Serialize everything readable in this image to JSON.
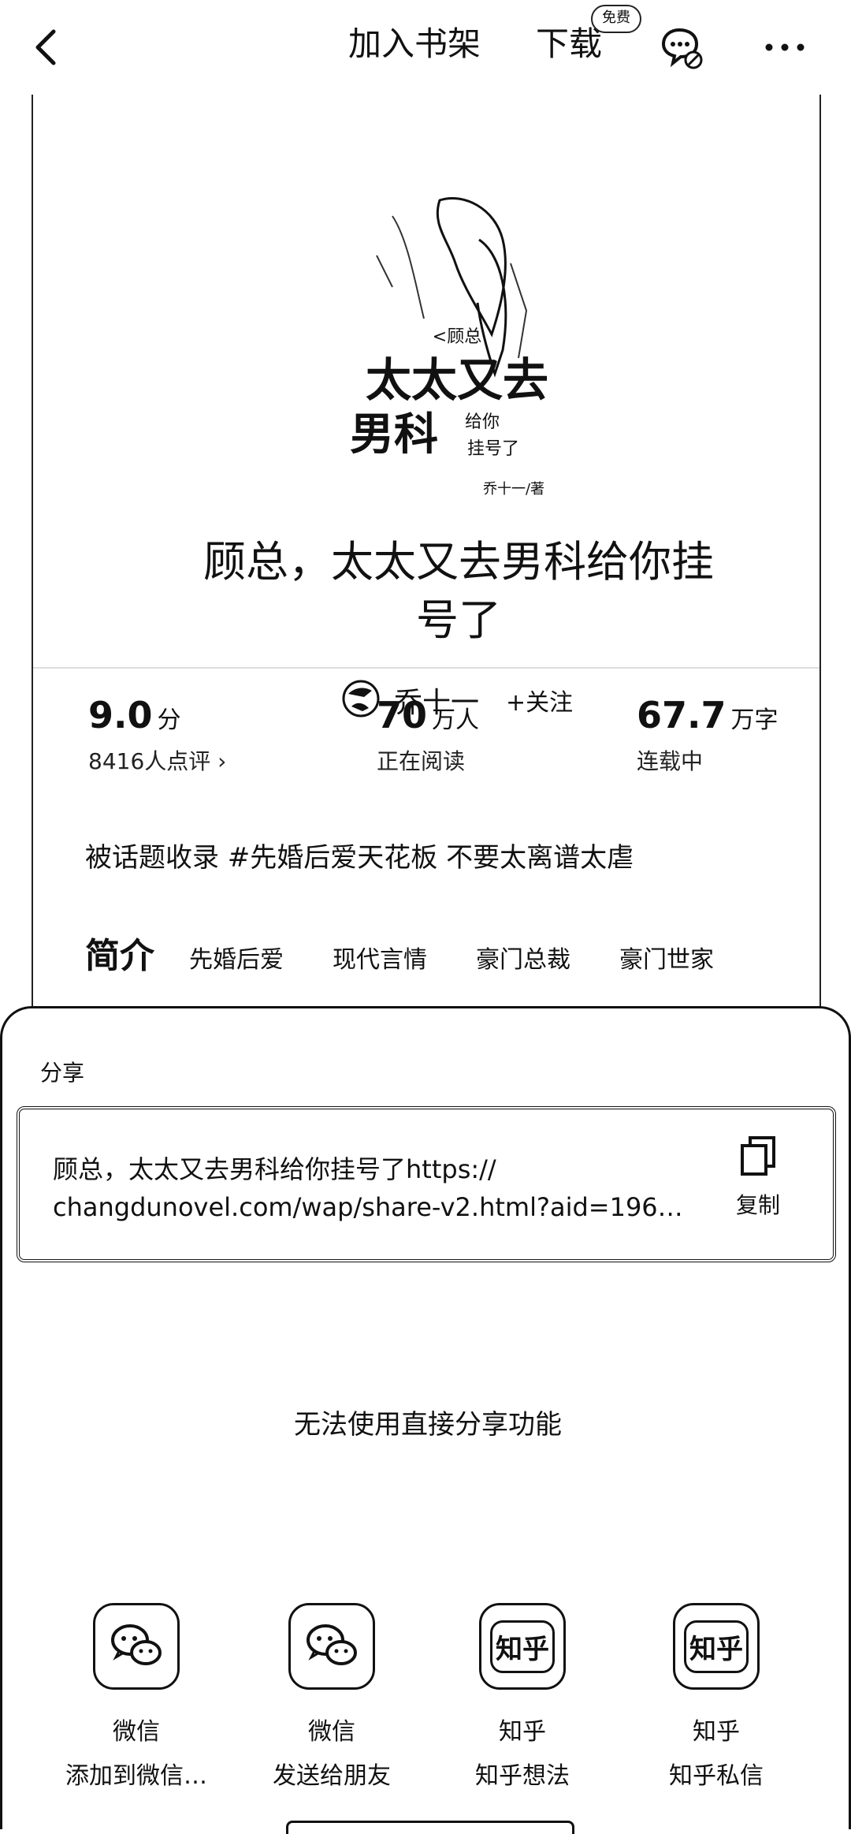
{
  "topbar": {
    "add_to_shelf": "加入书架",
    "download": "下载",
    "free_badge": "免费",
    "icons": [
      "back-arrow-icon",
      "comment-off-icon",
      "more-icon"
    ]
  },
  "book": {
    "cover_text": [
      "<顾总",
      "太太又去",
      "男科",
      "给你",
      "挂号了",
      "乔十一/著"
    ],
    "title_line1": "顾总，太太又去男科给你挂",
    "title_line2": "号了",
    "author": "乔十一",
    "follow": "+关注",
    "stats": [
      {
        "value": "9.0",
        "unit": "分",
        "label": "8416人点评 ›"
      },
      {
        "value": "70",
        "unit": "万人",
        "label": "正在阅读"
      },
      {
        "value": "67.7",
        "unit": "万字",
        "label": "连载中"
      }
    ],
    "topic": "被话题收录 #先婚后爱天花板 不要太离谱太虐",
    "intro_title": "简介",
    "tags": [
      "先婚后爱",
      "现代言情",
      "豪门总裁",
      "豪门世家"
    ]
  },
  "share": {
    "title": "分享",
    "link_line1": "顾总，太太又去男科给你挂号了https://",
    "link_line2": "changdunovel.com/wap/share-v2.html?aid=196…",
    "copy_label": "复制",
    "notice": "无法使用直接分享功能",
    "targets": [
      {
        "name": "微信",
        "desc": "添加到微信…",
        "icon": "wechat-icon"
      },
      {
        "name": "微信",
        "desc": "发送给朋友",
        "icon": "wechat-icon"
      },
      {
        "name": "知乎",
        "desc": "知乎想法",
        "icon": "zhihu-icon",
        "glyph": "知乎"
      },
      {
        "name": "知乎",
        "desc": "知乎私信",
        "icon": "zhihu-icon",
        "glyph": "知乎"
      }
    ]
  }
}
